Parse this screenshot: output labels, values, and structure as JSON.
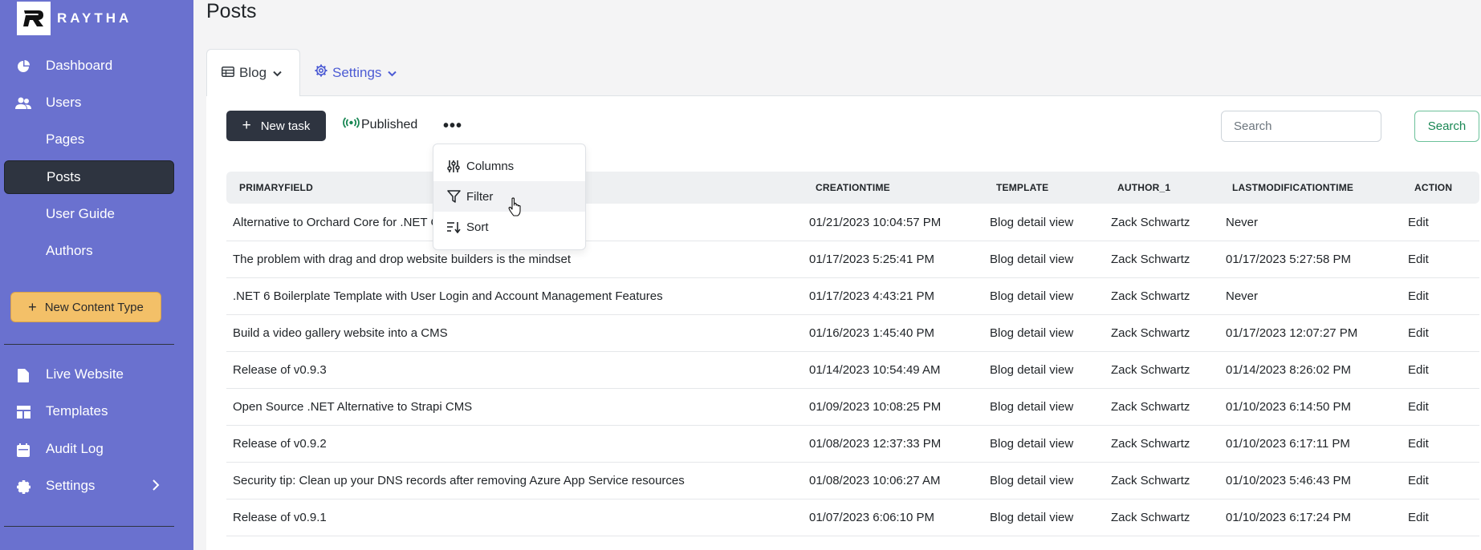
{
  "brand": {
    "name": "RAYTHA"
  },
  "sidebar": {
    "items": [
      {
        "label": "Dashboard",
        "icon": "pie-chart-icon"
      },
      {
        "label": "Users",
        "icon": "people-icon"
      },
      {
        "label": "Pages",
        "icon": ""
      },
      {
        "label": "Posts",
        "icon": "",
        "active": true
      },
      {
        "label": "User Guide",
        "icon": ""
      },
      {
        "label": "Authors",
        "icon": ""
      }
    ],
    "new_content_type": "New Content Type",
    "bottom_items": [
      {
        "label": "Live Website",
        "icon": "file-icon"
      },
      {
        "label": "Templates",
        "icon": "layout-icon"
      },
      {
        "label": "Audit Log",
        "icon": "calendar-icon"
      },
      {
        "label": "Settings",
        "icon": "gear-icon"
      }
    ]
  },
  "page": {
    "title": "Posts"
  },
  "tabs": [
    {
      "label": "Blog",
      "icon": "table-icon"
    },
    {
      "label": "Settings",
      "icon": "gear-icon"
    }
  ],
  "toolbar": {
    "new_task": "New task",
    "published": "Published",
    "more": "•••",
    "search_placeholder": "Search",
    "search_button": "Search"
  },
  "dropdown": {
    "items": [
      {
        "label": "Columns",
        "icon": "sliders-icon"
      },
      {
        "label": "Filter",
        "icon": "funnel-icon"
      },
      {
        "label": "Sort",
        "icon": "sort-icon"
      }
    ]
  },
  "table": {
    "columns": [
      "PRIMARYFIELD",
      "CREATIONTIME",
      "TEMPLATE",
      "AUTHOR_1",
      "LASTMODIFICATIONTIME",
      "ACTION"
    ],
    "rows": [
      [
        "Alternative to Orchard Core for .NET C",
        "01/21/2023 10:04:57 PM",
        "Blog detail view",
        "Zack Schwartz",
        "Never",
        "Edit"
      ],
      [
        "The problem with drag and drop website builders is the mindset",
        "01/17/2023 5:25:41 PM",
        "Blog detail view",
        "Zack Schwartz",
        "01/17/2023 5:27:58 PM",
        "Edit"
      ],
      [
        ".NET 6 Boilerplate Template with User Login and Account Management Features",
        "01/17/2023 4:43:21 PM",
        "Blog detail view",
        "Zack Schwartz",
        "Never",
        "Edit"
      ],
      [
        "Build a video gallery website into a CMS",
        "01/16/2023 1:45:40 PM",
        "Blog detail view",
        "Zack Schwartz",
        "01/17/2023 12:07:27 PM",
        "Edit"
      ],
      [
        "Release of v0.9.3",
        "01/14/2023 10:54:49 AM",
        "Blog detail view",
        "Zack Schwartz",
        "01/14/2023 8:26:02 PM",
        "Edit"
      ],
      [
        "Open Source .NET Alternative to Strapi CMS",
        "01/09/2023 10:08:25 PM",
        "Blog detail view",
        "Zack Schwartz",
        "01/10/2023 6:14:50 PM",
        "Edit"
      ],
      [
        "Release of v0.9.2",
        "01/08/2023 12:37:33 PM",
        "Blog detail view",
        "Zack Schwartz",
        "01/10/2023 6:17:11 PM",
        "Edit"
      ],
      [
        "Security tip: Clean up your DNS records after removing Azure App Service resources",
        "01/08/2023 10:06:27 AM",
        "Blog detail view",
        "Zack Schwartz",
        "01/10/2023 5:46:43 PM",
        "Edit"
      ],
      [
        "Release of v0.9.1",
        "01/07/2023 6:06:10 PM",
        "Blog detail view",
        "Zack Schwartz",
        "01/10/2023 6:17:24 PM",
        "Edit"
      ]
    ]
  }
}
